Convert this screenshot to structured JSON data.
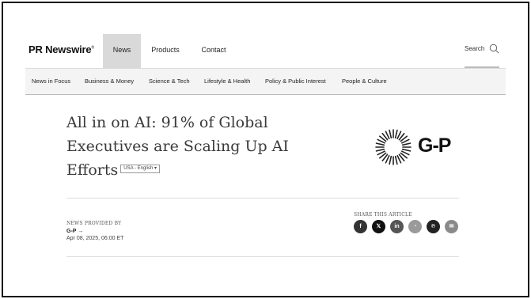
{
  "header": {
    "logo": "PR Newswire",
    "logo_mark": "®",
    "nav": [
      "News",
      "Products",
      "Contact"
    ],
    "search_label": "Search"
  },
  "categories": [
    "News in Focus",
    "Business & Money",
    "Science & Tech",
    "Lifestyle & Health",
    "Policy & Public Interest",
    "People & Culture"
  ],
  "article": {
    "title": "All in on AI: 91% of Global Executives are Scaling Up AI Efforts",
    "language": "USA - English ▾",
    "brand_logo_text": "G-P",
    "provided_by_label": "NEWS PROVIDED BY",
    "provider": "G-P →",
    "date": "Apr 08, 2025, 06:00 ET"
  },
  "share": {
    "label": "SHARE THIS ARTICLE",
    "buttons": [
      {
        "icon": "facebook-icon",
        "glyph": "f",
        "color": "#333333"
      },
      {
        "icon": "x-icon",
        "glyph": "𝕏",
        "color": "#111111"
      },
      {
        "icon": "linkedin-icon",
        "glyph": "in",
        "color": "#555555"
      },
      {
        "icon": "whatsapp-icon",
        "glyph": "◔",
        "color": "#9a9a9a"
      },
      {
        "icon": "pinterest-icon",
        "glyph": "℗",
        "color": "#222222"
      },
      {
        "icon": "email-icon",
        "glyph": "✉",
        "color": "#8a8a8a"
      }
    ]
  }
}
